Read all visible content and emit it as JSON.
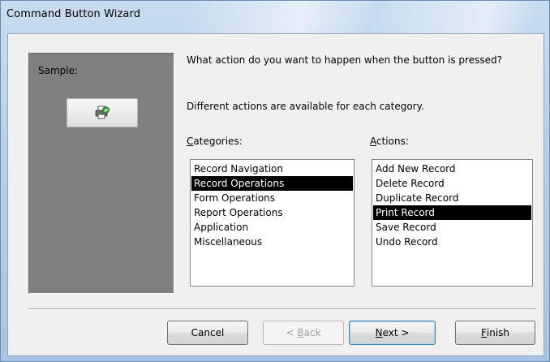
{
  "window": {
    "title": "Command Button Wizard"
  },
  "sample": {
    "label": "Sample:",
    "button_icon": "print-record-icon"
  },
  "prompt": {
    "question": "What action do you want to happen when the button is pressed?",
    "info": "Different actions are available for each category."
  },
  "categories": {
    "label_prefix": "",
    "label_accel": "C",
    "label_rest": "ategories:",
    "items": [
      {
        "label": "Record Navigation",
        "selected": false
      },
      {
        "label": "Record Operations",
        "selected": true
      },
      {
        "label": "Form Operations",
        "selected": false
      },
      {
        "label": "Report Operations",
        "selected": false
      },
      {
        "label": "Application",
        "selected": false
      },
      {
        "label": "Miscellaneous",
        "selected": false
      }
    ]
  },
  "actions": {
    "label_accel": "A",
    "label_rest": "ctions:",
    "items": [
      {
        "label": "Add New Record",
        "selected": false
      },
      {
        "label": "Delete Record",
        "selected": false
      },
      {
        "label": "Duplicate Record",
        "selected": false
      },
      {
        "label": "Print Record",
        "selected": true
      },
      {
        "label": "Save Record",
        "selected": false
      },
      {
        "label": "Undo Record",
        "selected": false
      }
    ]
  },
  "buttons": {
    "cancel": "Cancel",
    "back_pre": "< ",
    "back_accel": "B",
    "back_rest": "ack",
    "next_accel": "N",
    "next_rest": "ext >",
    "finish_accel": "F",
    "finish_rest": "inish"
  },
  "colors": {
    "selection": "#000000",
    "sample_panel": "#808080",
    "client": "#f0f0f0"
  }
}
